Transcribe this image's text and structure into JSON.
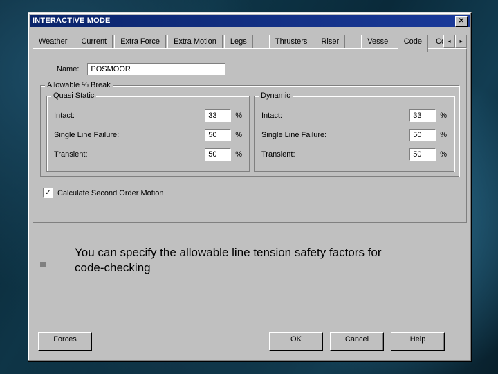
{
  "window": {
    "title": "INTERACTIVE MODE"
  },
  "tabs": {
    "weather": "Weather",
    "current": "Current",
    "extraforce": "Extra Force",
    "extramotion": "Extra Motion",
    "legs": "Legs",
    "thrusters": "Thrusters",
    "riser": "Riser",
    "vessel": "Vessel",
    "code": "Code",
    "cor": "Cor"
  },
  "name": {
    "label": "Name:",
    "value": "POSMOOR"
  },
  "groups": {
    "outer": "Allowable % Break",
    "qs": "Quasi Static",
    "dy": "Dynamic"
  },
  "fields": {
    "intact": "Intact:",
    "single": "Single Line Failure:",
    "transient": "Transient:",
    "pct": "%"
  },
  "qs": {
    "intact": "33",
    "single": "50",
    "transient": "50"
  },
  "dy": {
    "intact": "33",
    "single": "50",
    "transient": "50"
  },
  "checkbox": {
    "label": "Calculate Second Order Motion",
    "checked": "✓"
  },
  "buttons": {
    "forces": "Forces",
    "ok": "OK",
    "cancel": "Cancel",
    "help": "Help"
  },
  "caption": "You can specify the allowable line tension safety factors for code-checking"
}
